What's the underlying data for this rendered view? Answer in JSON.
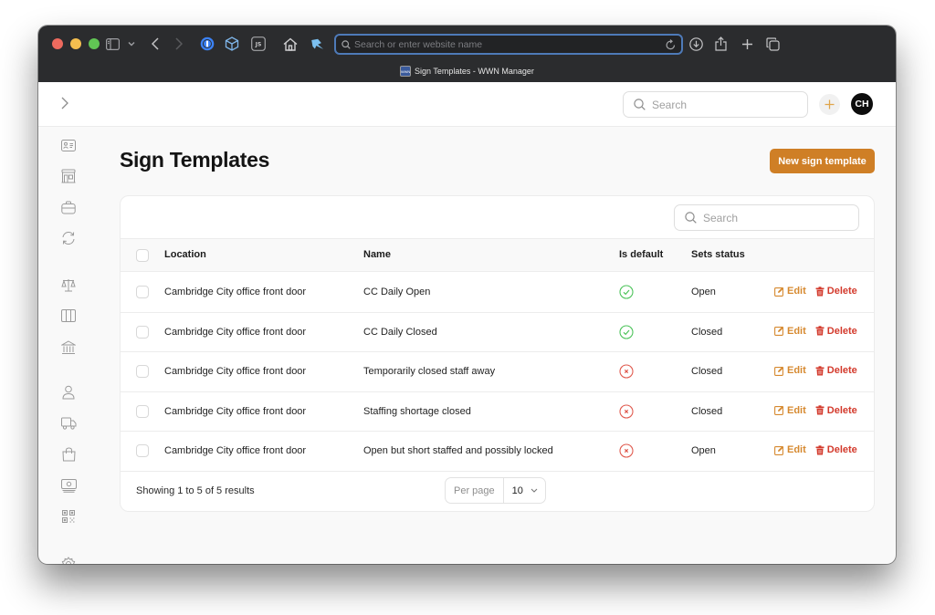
{
  "browser": {
    "url_placeholder": "Search or enter website name",
    "tab_title": "Sign Templates - WWN Manager",
    "favicon_text": "WWN",
    "toolbar_icons": [
      "sidebar-icon",
      "chevron-down-icon",
      "back-icon",
      "forward-icon",
      "1password-icon",
      "cube-extension-icon",
      "js-extension-icon",
      "home-icon",
      "pin-icon",
      "reload-icon",
      "download-icon",
      "share-icon",
      "new-tab-icon",
      "tab-overview-icon"
    ]
  },
  "appbar": {
    "search_placeholder": "Search",
    "avatar_initials": "CH"
  },
  "sidebar": {
    "items": [
      {
        "icon": "contact-card-icon"
      },
      {
        "icon": "storefront-icon"
      },
      {
        "icon": "briefcase-icon"
      },
      {
        "icon": "sync-icon"
      },
      {
        "icon": "scales-icon"
      },
      {
        "icon": "columns-icon"
      },
      {
        "icon": "bank-icon"
      },
      {
        "icon": "user-icon"
      },
      {
        "icon": "truck-icon"
      },
      {
        "icon": "shopping-bag-icon"
      },
      {
        "icon": "cash-icon"
      },
      {
        "icon": "qr-code-icon"
      },
      {
        "icon": "settings-icon"
      }
    ]
  },
  "page": {
    "title": "Sign Templates",
    "new_button": "New sign template"
  },
  "table": {
    "search_placeholder": "Search",
    "columns": [
      "Location",
      "Name",
      "Is default",
      "Sets status"
    ],
    "rows": [
      {
        "location": "Cambridge City office front door",
        "name": "CC Daily Open",
        "is_default": true,
        "status": "Open"
      },
      {
        "location": "Cambridge City office front door",
        "name": "CC Daily Closed",
        "is_default": true,
        "status": "Closed"
      },
      {
        "location": "Cambridge City office front door",
        "name": "Temporarily closed staff away",
        "is_default": false,
        "status": "Closed"
      },
      {
        "location": "Cambridge City office front door",
        "name": "Staffing shortage closed",
        "is_default": false,
        "status": "Closed"
      },
      {
        "location": "Cambridge City office front door",
        "name": "Open but short staffed and possibly locked",
        "is_default": false,
        "status": "Open"
      }
    ],
    "edit_label": "Edit",
    "delete_label": "Delete",
    "footer_text": "Showing 1 to 5 of 5 results",
    "per_page_label": "Per page",
    "per_page_value": "10"
  },
  "colors": {
    "accent": "#cf7f26",
    "edit": "#d6892f",
    "delete": "#d33a2c",
    "default_true": "#4cc35a",
    "default_false": "#e05a4e"
  }
}
